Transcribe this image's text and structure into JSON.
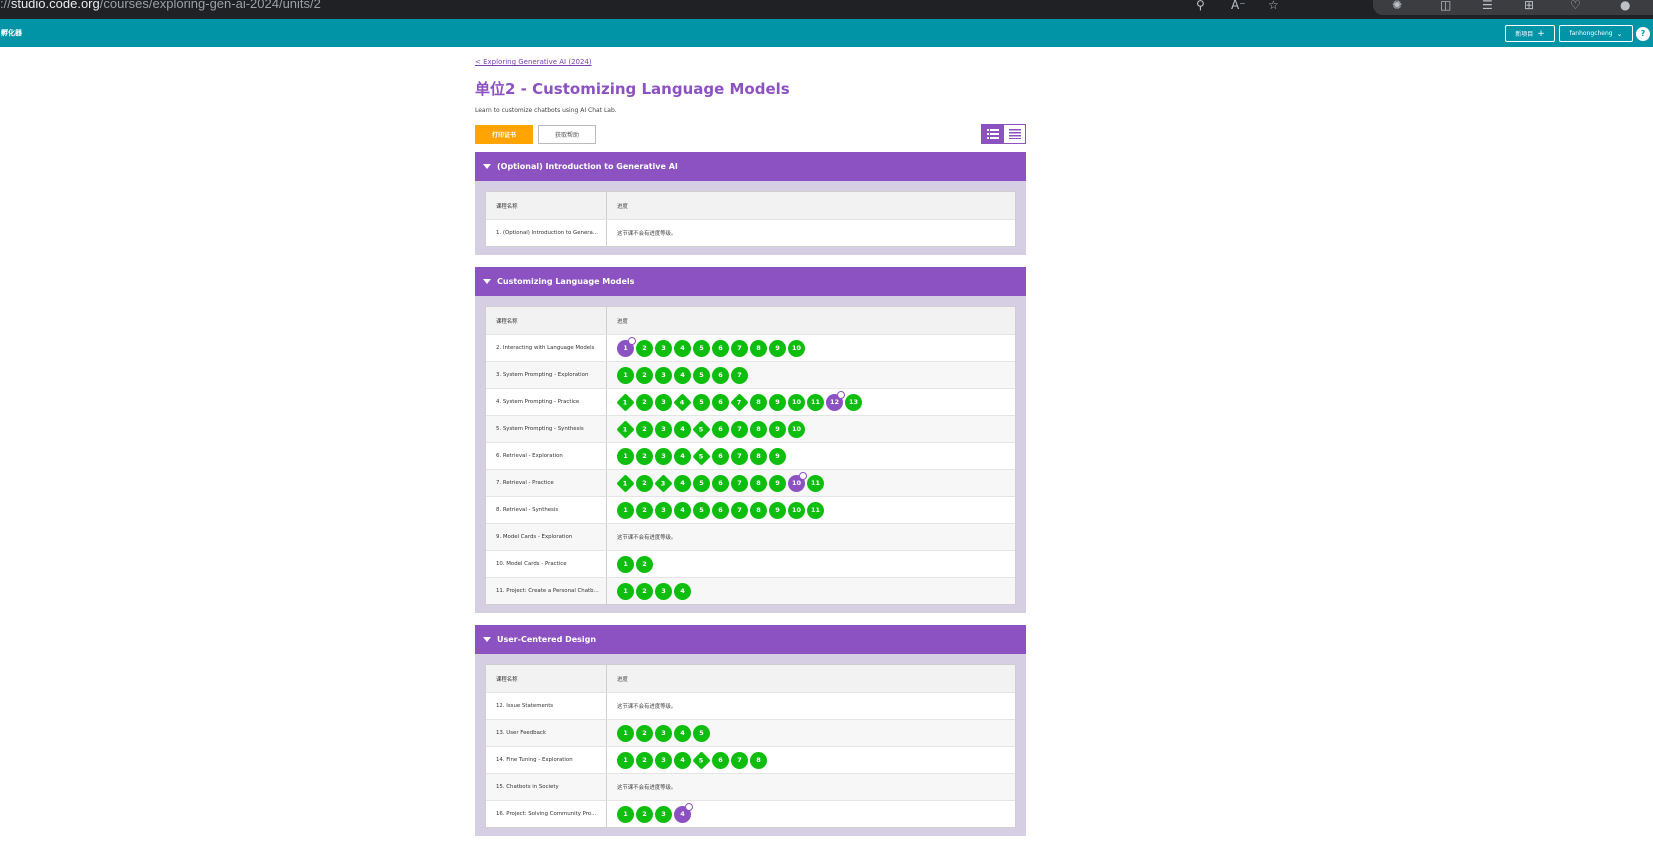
{
  "browser": {
    "url_prefix": "://",
    "url_host": "studio.code.org",
    "url_path": "/courses/exploring-gen-ai-2024/units/2"
  },
  "header": {
    "title": "孵化器",
    "new_project_label": "新项目",
    "username": "fanhongcheng",
    "help_label": "?"
  },
  "page": {
    "breadcrumb": "< Exploring Generative AI (2024)",
    "title": "单位2 - Customizing Language Models",
    "description": "Learn to customize chatbots using AI Chat Lab.",
    "print_button": "打印证书",
    "help_button": "获取帮助"
  },
  "table_headers": {
    "name": "课程名称",
    "progress": "进度"
  },
  "no_progress_text": "这节课不会有进度等级。",
  "sections": [
    {
      "title": "(Optional) Introduction to Generative AI",
      "lessons": [
        {
          "name": "1. (Optional) Introduction to Genera...",
          "levels": []
        }
      ]
    },
    {
      "title": "Customizing Language Models",
      "lessons": [
        {
          "name": "2. Interacting with Language Models",
          "levels": [
            [
              "1",
              "pc"
            ],
            [
              "2",
              "c"
            ],
            [
              "3",
              "c"
            ],
            [
              "4",
              "c"
            ],
            [
              "5",
              "c"
            ],
            [
              "6",
              "c"
            ],
            [
              "7",
              "c"
            ],
            [
              "8",
              "c"
            ],
            [
              "9",
              "c"
            ],
            [
              "10",
              "c"
            ]
          ]
        },
        {
          "name": "3. System Prompting - Exploration",
          "levels": [
            [
              "1",
              "c"
            ],
            [
              "2",
              "c"
            ],
            [
              "3",
              "c"
            ],
            [
              "4",
              "c"
            ],
            [
              "5",
              "c"
            ],
            [
              "6",
              "c"
            ],
            [
              "7",
              "c"
            ]
          ]
        },
        {
          "name": "4. System Prompting - Practice",
          "levels": [
            [
              "1",
              "d"
            ],
            [
              "2",
              "c"
            ],
            [
              "3",
              "c"
            ],
            [
              "4",
              "d"
            ],
            [
              "5",
              "c"
            ],
            [
              "6",
              "c"
            ],
            [
              "7",
              "d"
            ],
            [
              "8",
              "c"
            ],
            [
              "9",
              "c"
            ],
            [
              "10",
              "c"
            ],
            [
              "11",
              "c"
            ],
            [
              "12",
              "pc"
            ],
            [
              "13",
              "c"
            ]
          ]
        },
        {
          "name": "5. System Prompting - Synthesis",
          "levels": [
            [
              "1",
              "d"
            ],
            [
              "2",
              "c"
            ],
            [
              "3",
              "c"
            ],
            [
              "4",
              "c"
            ],
            [
              "5",
              "d"
            ],
            [
              "6",
              "c"
            ],
            [
              "7",
              "c"
            ],
            [
              "8",
              "c"
            ],
            [
              "9",
              "c"
            ],
            [
              "10",
              "c"
            ]
          ]
        },
        {
          "name": "6. Retrieval - Exploration",
          "levels": [
            [
              "1",
              "c"
            ],
            [
              "2",
              "c"
            ],
            [
              "3",
              "c"
            ],
            [
              "4",
              "c"
            ],
            [
              "5",
              "d"
            ],
            [
              "6",
              "c"
            ],
            [
              "7",
              "c"
            ],
            [
              "8",
              "c"
            ],
            [
              "9",
              "c"
            ]
          ]
        },
        {
          "name": "7. Retrieval - Practice",
          "levels": [
            [
              "1",
              "d"
            ],
            [
              "2",
              "c"
            ],
            [
              "3",
              "d"
            ],
            [
              "4",
              "c"
            ],
            [
              "5",
              "c"
            ],
            [
              "6",
              "c"
            ],
            [
              "7",
              "c"
            ],
            [
              "8",
              "c"
            ],
            [
              "9",
              "c"
            ],
            [
              "10",
              "pc"
            ],
            [
              "11",
              "c"
            ]
          ]
        },
        {
          "name": "8. Retrieval - Synthesis",
          "levels": [
            [
              "1",
              "c"
            ],
            [
              "2",
              "c"
            ],
            [
              "3",
              "c"
            ],
            [
              "4",
              "c"
            ],
            [
              "5",
              "c"
            ],
            [
              "6",
              "c"
            ],
            [
              "7",
              "c"
            ],
            [
              "8",
              "c"
            ],
            [
              "9",
              "c"
            ],
            [
              "10",
              "c"
            ],
            [
              "11",
              "c"
            ]
          ]
        },
        {
          "name": "9. Model Cards - Exploration",
          "levels": []
        },
        {
          "name": "10. Model Cards - Practice",
          "levels": [
            [
              "1",
              "c"
            ],
            [
              "2",
              "c"
            ]
          ]
        },
        {
          "name": "11. Project: Create a Personal Chatb...",
          "levels": [
            [
              "1",
              "c"
            ],
            [
              "2",
              "c"
            ],
            [
              "3",
              "c"
            ],
            [
              "4",
              "c"
            ]
          ]
        }
      ]
    },
    {
      "title": "User-Centered Design",
      "lessons": [
        {
          "name": "12. Issue Statements",
          "levels": []
        },
        {
          "name": "13. User Feedback",
          "levels": [
            [
              "1",
              "c"
            ],
            [
              "2",
              "c"
            ],
            [
              "3",
              "c"
            ],
            [
              "4",
              "c"
            ],
            [
              "5",
              "c"
            ]
          ]
        },
        {
          "name": "14. Fine Tuning - Exploration",
          "levels": [
            [
              "1",
              "c"
            ],
            [
              "2",
              "c"
            ],
            [
              "3",
              "c"
            ],
            [
              "4",
              "c"
            ],
            [
              "5",
              "d"
            ],
            [
              "6",
              "c"
            ],
            [
              "7",
              "c"
            ],
            [
              "8",
              "c"
            ]
          ]
        },
        {
          "name": "15. Chatbots in Society",
          "levels": []
        },
        {
          "name": "16. Project: Solving Community Pro...",
          "levels": [
            [
              "1",
              "c"
            ],
            [
              "2",
              "c"
            ],
            [
              "3",
              "c"
            ],
            [
              "4",
              "pc"
            ]
          ]
        }
      ]
    }
  ],
  "colors": {
    "header_teal": "#0094a6",
    "purple": "#8c52c2",
    "green": "#0ebe0e",
    "orange": "#ffa400"
  }
}
